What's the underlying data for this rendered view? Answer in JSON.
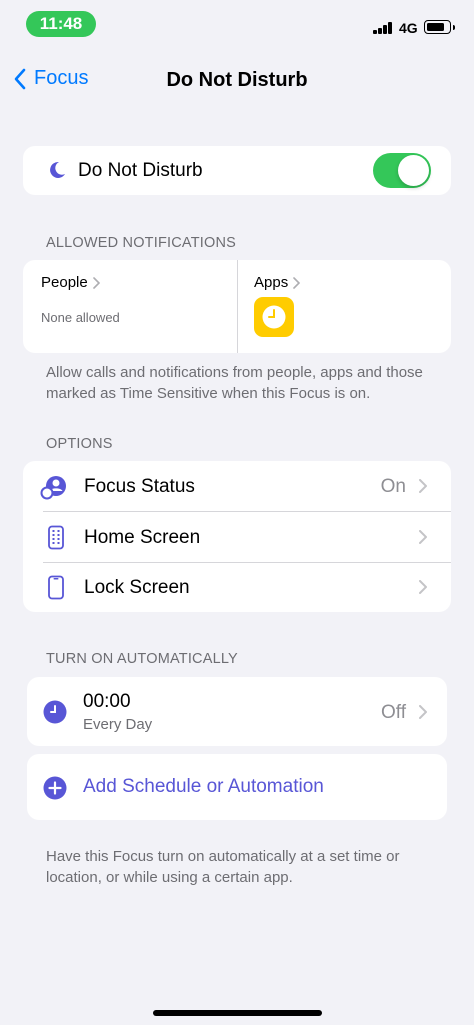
{
  "status_bar": {
    "time": "11:48",
    "network": "4G"
  },
  "nav": {
    "back_label": "Focus",
    "title": "Do Not Disturb"
  },
  "dnd": {
    "label": "Do Not Disturb",
    "enabled": true
  },
  "allowed": {
    "header": "ALLOWED NOTIFICATIONS",
    "people_label": "People",
    "people_value": "None allowed",
    "apps_label": "Apps",
    "footnote": "Allow calls and notifications from people, apps and those marked as Time Sensitive when this Focus is on."
  },
  "options": {
    "header": "OPTIONS",
    "items": [
      {
        "label": "Focus Status",
        "value": "On"
      },
      {
        "label": "Home Screen",
        "value": ""
      },
      {
        "label": "Lock Screen",
        "value": ""
      }
    ]
  },
  "automation": {
    "header": "TURN ON AUTOMATICALLY",
    "schedule_time": "00:00",
    "schedule_repeat": "Every Day",
    "schedule_state": "Off",
    "add_label": "Add Schedule or Automation",
    "footnote": "Have this Focus turn on automatically at a set time or location, or while using a certain app."
  },
  "colors": {
    "accent": "#5856d6",
    "tint": "#007aff",
    "toggle_on": "#34c759",
    "clock_app": "#ffcc00"
  }
}
